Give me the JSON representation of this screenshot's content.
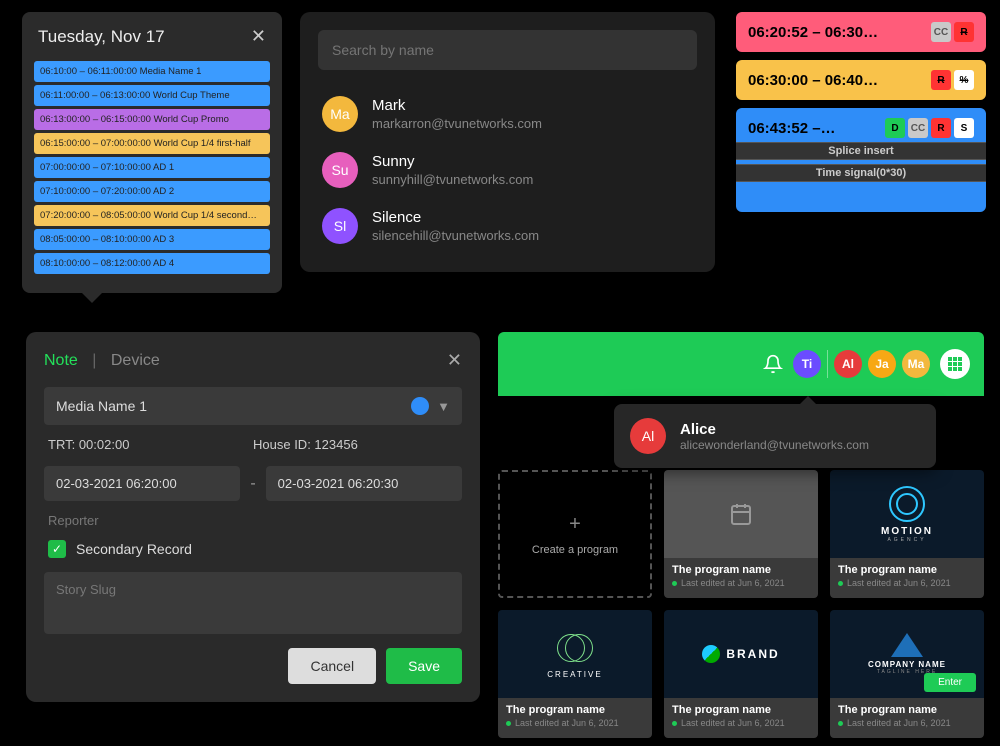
{
  "schedule": {
    "title": "Tuesday, Nov 17",
    "rows": [
      {
        "text": "06:10:00 – 06:11:00:00 Media Name 1",
        "color": "blue"
      },
      {
        "text": "06:11:00:00 – 06:13:00:00 World Cup Theme",
        "color": "blue"
      },
      {
        "text": "06:13:00:00 – 06:15:00:00 World Cup Promo",
        "color": "purple"
      },
      {
        "text": "06:15:00:00 – 07:00:00:00 World Cup 1/4 first-half",
        "color": "orange"
      },
      {
        "text": "07:00:00:00 – 07:10:00:00 AD 1",
        "color": "blue"
      },
      {
        "text": "07:10:00:00 – 07:20:00:00 AD 2",
        "color": "blue"
      },
      {
        "text": "07:20:00:00 – 08:05:00:00 World Cup 1/4 second…",
        "color": "orange"
      },
      {
        "text": "08:05:00:00 – 08:10:00:00 AD 3",
        "color": "blue"
      },
      {
        "text": "08:10:00:00 – 08:12:00:00 AD 4",
        "color": "blue"
      }
    ]
  },
  "search": {
    "placeholder": "Search by name",
    "contacts": [
      {
        "initials": "Ma",
        "color": "#f3b83d",
        "name": "Mark",
        "email": "markarron@tvunetworks.com"
      },
      {
        "initials": "Su",
        "color": "#e75fbd",
        "name": "Sunny",
        "email": "sunnyhill@tvunetworks.com"
      },
      {
        "initials": "Sl",
        "color": "#8f52ff",
        "name": "Silence",
        "email": "silencehill@tvunetworks.com"
      }
    ]
  },
  "timecards": [
    {
      "time": "06:20:52 – 06:30…",
      "bg": "pink",
      "tags": [
        {
          "t": "CC",
          "bg": "#c9c9c9",
          "c": "#555"
        },
        {
          "t": "R",
          "bg": "#ff3333",
          "c": "#000",
          "strike": true
        }
      ]
    },
    {
      "time": "06:30:00 – 06:40…",
      "bg": "yellow",
      "tags": [
        {
          "t": "R",
          "bg": "#ff3333",
          "c": "#000",
          "strike": true
        },
        {
          "t": "%",
          "bg": "#fff",
          "c": "#000",
          "strike": true
        }
      ]
    },
    {
      "time": "06:43:52 –…",
      "bg": "blue2",
      "tags": [
        {
          "t": "D",
          "bg": "#1ecb56",
          "c": "#000"
        },
        {
          "t": "CC",
          "bg": "#c9c9c9",
          "c": "#555"
        },
        {
          "t": "R",
          "bg": "#ff3333",
          "c": "#000"
        },
        {
          "t": "S",
          "bg": "#fff",
          "c": "#000"
        }
      ],
      "subs": [
        "Splice insert",
        "Time signal(0*30)"
      ]
    }
  ],
  "note": {
    "tab_note": "Note",
    "tab_device": "Device",
    "media_name": "Media Name 1",
    "trt_label": "TRT: 00:02:00",
    "house_label": "House ID: 123456",
    "dt_start": "02-03-2021 06:20:00",
    "dt_end": "02-03-2021 06:20:30",
    "reporter_ph": "Reporter",
    "secondary_label": "Secondary Record",
    "story_ph": "Story Slug",
    "cancel": "Cancel",
    "save": "Save"
  },
  "greenbar": {
    "avatars": [
      {
        "t": "Ti",
        "c": "#6b4cff"
      },
      {
        "t": "Al",
        "c": "#e63b3b"
      },
      {
        "t": "Ja",
        "c": "#f7a815"
      },
      {
        "t": "Ma",
        "c": "#f3b83d"
      }
    ]
  },
  "alice": {
    "initials": "Al",
    "color": "#e63b3b",
    "name": "Alice",
    "email": "alicewonderland@tvunetworks.com"
  },
  "programs": {
    "create_label": "Create a program",
    "enter_label": "Enter",
    "cards": [
      {
        "name": "The program name",
        "edited": "Last edited at Jun 6, 2021"
      },
      {
        "name": "The program name",
        "edited": "Last edited at Jun 6, 2021"
      },
      {
        "name": "The program name",
        "edited": "Last edited at Jun 6, 2021"
      },
      {
        "name": "The program name",
        "edited": "Last edited at Jun 6, 2021"
      },
      {
        "name": "The program name",
        "edited": "Last edited at Jun 6, 2021"
      }
    ],
    "logos": {
      "motion": "MOTION",
      "motion_sub": "AGENCY",
      "creative": "CREATIVE",
      "brand": "BRAND",
      "company": "COMPANY NAME",
      "company_sub": "TAGLINE HERE"
    }
  }
}
